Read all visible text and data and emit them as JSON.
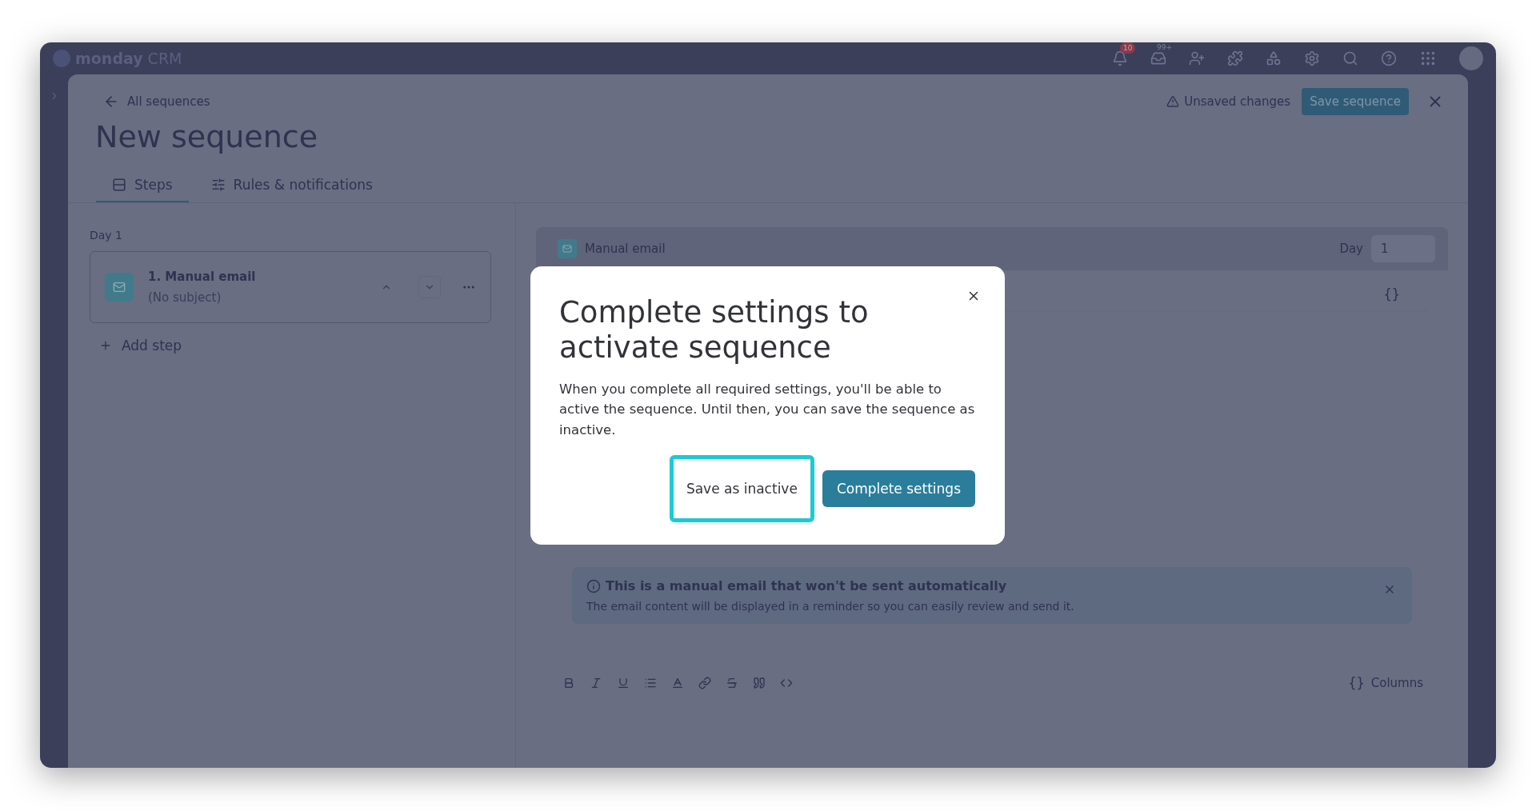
{
  "app_header": {
    "logo_word": "monday",
    "logo_suffix": "CRM",
    "notification_count": "10",
    "inbox_count": "99+"
  },
  "top_bar": {
    "back_link": "All sequences",
    "status": "Unsaved changes",
    "save_button": "Save sequence"
  },
  "title": "New sequence",
  "tabs": [
    {
      "label": "Steps",
      "selected": true
    },
    {
      "label": "Rules & notifications",
      "selected": false
    }
  ],
  "steps_panel": {
    "day_label": "Day 1",
    "steps": [
      {
        "title": "1. Manual email",
        "subtitle": "(No subject)"
      }
    ],
    "add_step": "Add step"
  },
  "step_editor": {
    "header": "Manual email",
    "day_label": "Day",
    "day_value": "1",
    "variables_symbol": "{}",
    "notice": {
      "title": "This is a manual email that won't be sent automatically",
      "body": "The email content will be displayed in a reminder so you can easily review and send it."
    },
    "toolbar": {
      "columns_symbol": "{}",
      "columns_label": "Columns"
    }
  },
  "dialog": {
    "title": "Complete settings to activate sequence",
    "body": "When you complete all required settings, you'll be able to active the sequence. Until then, you can save the sequence as inactive.",
    "buttons": [
      {
        "label": "Save as inactive",
        "kind": "secondary",
        "highlighted": true
      },
      {
        "label": "Complete settings",
        "kind": "primary",
        "highlighted": false
      }
    ]
  }
}
